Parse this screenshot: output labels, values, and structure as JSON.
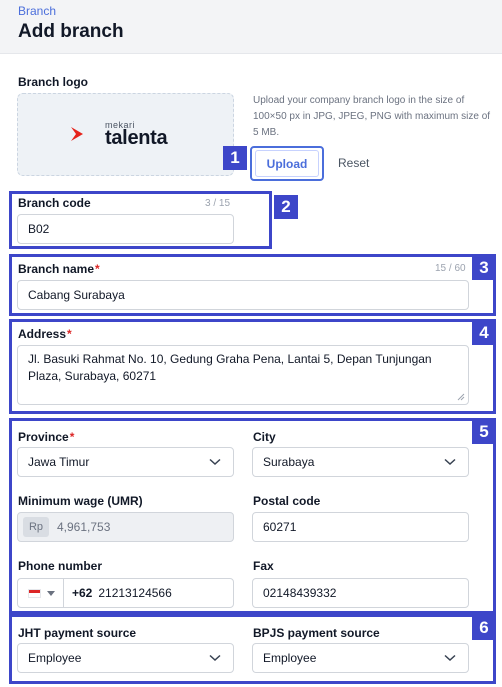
{
  "header": {
    "breadcrumb": "Branch",
    "title": "Add branch"
  },
  "logo": {
    "label": "Branch logo",
    "brand_small": "mekari",
    "brand_big": "talenta",
    "help": "Upload your company branch logo in the size of 100×50 px in JPG, JPEG, PNG with maximum size of 5 MB.",
    "upload_label": "Upload",
    "reset_label": "Reset"
  },
  "branch_code": {
    "label": "Branch code",
    "counter": "3 / 15",
    "value": "B02"
  },
  "branch_name": {
    "label": "Branch name",
    "required": "*",
    "counter": "15 / 60",
    "value": "Cabang Surabaya"
  },
  "address": {
    "label": "Address",
    "required": "*",
    "line1": "Jl. Basuki Rahmat No. 10, Gedung Graha Pena, Lantai 5, Depan Tunjungan",
    "line2": "Plaza, Surabaya, 60271"
  },
  "province": {
    "label": "Province",
    "required": "*",
    "value": "Jawa Timur"
  },
  "city": {
    "label": "City",
    "value": "Surabaya"
  },
  "min_wage": {
    "label": "Minimum wage (UMR)",
    "prefix": "Rp",
    "value": "4,961,753"
  },
  "postal": {
    "label": "Postal code",
    "value": "60271"
  },
  "phone": {
    "label": "Phone number",
    "dial_code": "+62",
    "value": "21213124566"
  },
  "fax": {
    "label": "Fax",
    "value": "02148439332"
  },
  "jht": {
    "label": "JHT payment source",
    "value": "Employee"
  },
  "bpjs": {
    "label": "BPJS payment source",
    "value": "Employee"
  },
  "annotations": [
    "1",
    "2",
    "3",
    "4",
    "5",
    "6"
  ],
  "colors": {
    "accent": "#4b6edb",
    "annotation": "#3d46c9",
    "required": "#dc2626",
    "brand": "#e5231b"
  }
}
